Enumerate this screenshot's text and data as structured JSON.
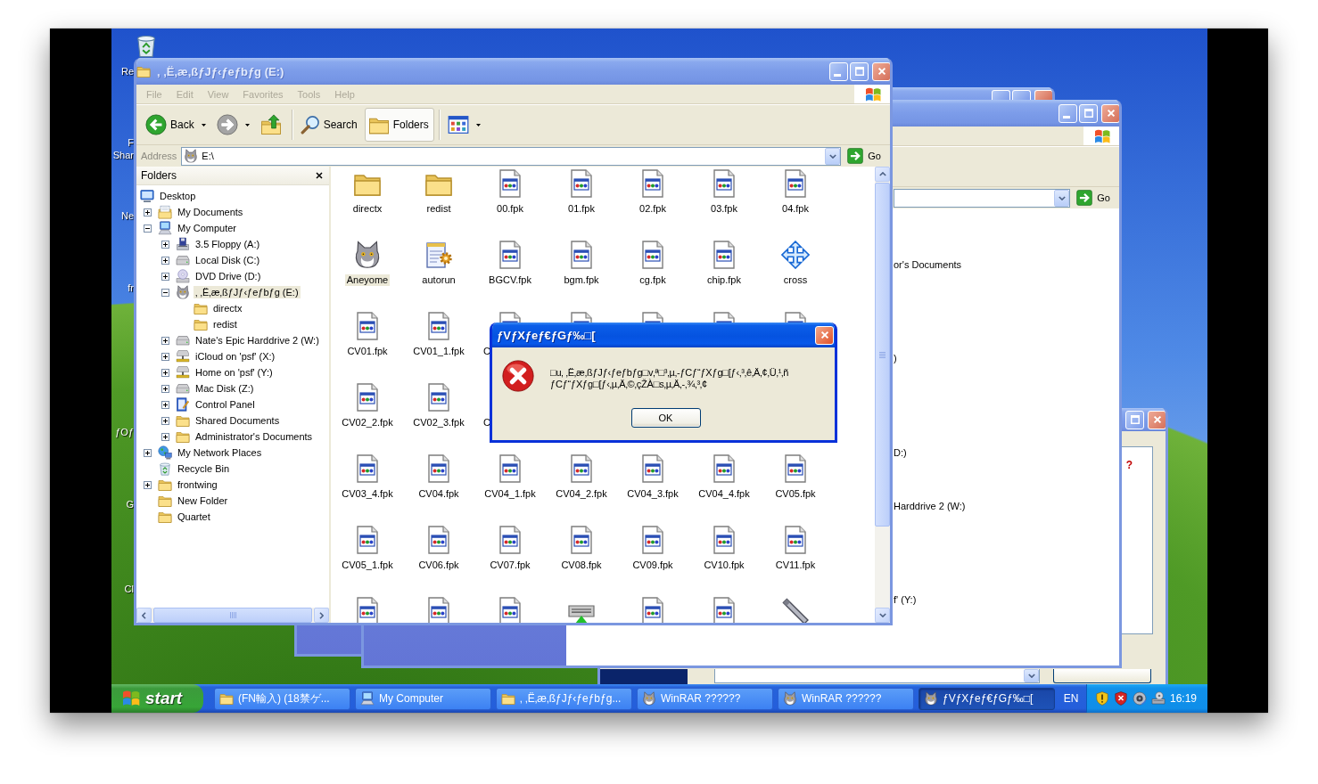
{
  "desktop_icons": [
    {
      "kind": "recycle-bin",
      "label": "Re"
    },
    {
      "label": "F\nShar"
    },
    {
      "label": "Ne"
    },
    {
      "label": "fr"
    },
    {
      "label": "ƒOƒ"
    },
    {
      "label": "G"
    },
    {
      "label": "Cl"
    }
  ],
  "background_windows": [
    {
      "kind": "dialog-window",
      "texts": [
        "?"
      ]
    },
    {
      "kind": "window-frame"
    },
    {
      "kind": "explorer-window",
      "go": "Go",
      "texts": [
        "or's Documents",
        ")",
        "D:)",
        "Harddrive 2 (W:)",
        "f' (Y:)"
      ]
    }
  ],
  "explorer": {
    "title": "‚ ‚Ë‚æ‚ßƒJƒ‹ƒeƒbƒg (E:)",
    "menu": [
      "File",
      "Edit",
      "View",
      "Favorites",
      "Tools",
      "Help"
    ],
    "toolbar": [
      {
        "kind": "back",
        "label": "Back",
        "disabled": false,
        "dropdown": true
      },
      {
        "kind": "forward",
        "disabled": true,
        "dropdown": true
      },
      {
        "kind": "up",
        "disabled": false
      },
      {
        "kind": "separator"
      },
      {
        "kind": "search",
        "label": "Search",
        "pressed": false
      },
      {
        "kind": "folders",
        "label": "Folders",
        "pressed": true
      },
      {
        "kind": "separator"
      },
      {
        "kind": "views",
        "dropdown": true
      }
    ],
    "address": {
      "label": "Address",
      "value": "E:\\",
      "go": "Go"
    },
    "folders_pane": {
      "title": "Folders",
      "tree": [
        {
          "label": "Desktop",
          "kind": "desktop",
          "selected": false,
          "children": [
            {
              "label": "My Documents",
              "kind": "documents",
              "expanded": false,
              "selected": false
            },
            {
              "label": "My Computer",
              "kind": "computer",
              "expanded": true,
              "selected": false,
              "children": [
                {
                  "label": "3.5 Floppy (A:)",
                  "kind": "floppy",
                  "expanded": false,
                  "selected": false
                },
                {
                  "label": "Local Disk (C:)",
                  "kind": "disk",
                  "expanded": false,
                  "selected": false
                },
                {
                  "label": "DVD Drive (D:)",
                  "kind": "dvd",
                  "expanded": false,
                  "selected": false
                },
                {
                  "label": "‚ ‚Ë‚æ‚ßƒJƒ‹ƒeƒbƒg (E:)",
                  "kind": "cat",
                  "expanded": true,
                  "selected": true,
                  "children": [
                    {
                      "label": "directx",
                      "kind": "folder",
                      "selected": false
                    },
                    {
                      "label": "redist",
                      "kind": "folder",
                      "selected": false
                    }
                  ]
                },
                {
                  "label": "Nate's Epic Harddrive 2 (W:)",
                  "kind": "disk",
                  "expanded": false,
                  "selected": false
                },
                {
                  "label": "iCloud on 'psf' (X:)",
                  "kind": "network-drive",
                  "expanded": false,
                  "selected": false
                },
                {
                  "label": "Home on 'psf' (Y:)",
                  "kind": "network-drive",
                  "expanded": false,
                  "selected": false
                },
                {
                  "label": "Mac Disk (Z:)",
                  "kind": "disk",
                  "expanded": false,
                  "selected": false
                },
                {
                  "label": "Control Panel",
                  "kind": "control-panel",
                  "expanded": false,
                  "selected": false
                },
                {
                  "label": "Shared Documents",
                  "kind": "folder",
                  "expanded": false,
                  "selected": false
                },
                {
                  "label": "Administrator's Documents",
                  "kind": "folder",
                  "expanded": false,
                  "selected": false
                }
              ]
            },
            {
              "label": "My Network Places",
              "kind": "network",
              "expanded": false,
              "selected": false
            },
            {
              "label": "Recycle Bin",
              "kind": "recycle-bin",
              "selected": false
            },
            {
              "label": "frontwing",
              "kind": "folder",
              "expanded": false,
              "selected": false
            },
            {
              "label": "New Folder",
              "kind": "folder",
              "selected": false
            },
            {
              "label": "Quartet",
              "kind": "folder",
              "selected": false
            }
          ]
        }
      ]
    },
    "files": {
      "rows": [
        [
          {
            "label": "directx",
            "kind": "folder",
            "selected": false
          },
          {
            "label": "redist",
            "kind": "folder",
            "selected": false
          },
          {
            "label": "00.fpk",
            "kind": "fpk",
            "selected": false
          },
          {
            "label": "01.fpk",
            "kind": "fpk",
            "selected": false
          },
          {
            "label": "02.fpk",
            "kind": "fpk",
            "selected": false
          },
          {
            "label": "03.fpk",
            "kind": "fpk",
            "selected": false
          },
          {
            "label": "04.fpk",
            "kind": "fpk",
            "selected": false
          }
        ],
        [
          {
            "label": "Aneyome",
            "kind": "cat",
            "selected": true
          },
          {
            "label": "autorun",
            "kind": "setup",
            "selected": false
          },
          {
            "label": "BGCV.fpk",
            "kind": "fpk",
            "selected": false
          },
          {
            "label": "bgm.fpk",
            "kind": "fpk",
            "selected": false
          },
          {
            "label": "cg.fpk",
            "kind": "fpk",
            "selected": false
          },
          {
            "label": "chip.fpk",
            "kind": "fpk",
            "selected": false
          },
          {
            "label": "cross",
            "kind": "arrows",
            "selected": false
          }
        ],
        [
          {
            "label": "CV01.fpk",
            "kind": "fpk",
            "selected": false
          },
          {
            "label": "CV01_1.fpk",
            "kind": "fpk",
            "selected": false
          },
          {
            "label": "C",
            "kind": "fpk",
            "covered": true,
            "selected": false
          },
          {
            "kind": "fpk",
            "selected": false
          },
          {
            "kind": "fpk",
            "selected": false
          },
          {
            "kind": "fpk",
            "selected": false
          },
          {
            "kind": "fpk",
            "selected": false
          }
        ],
        [
          {
            "label": "CV02_2.fpk",
            "kind": "fpk",
            "selected": false
          },
          {
            "label": "CV02_3.fpk",
            "kind": "fpk",
            "selected": false
          },
          {
            "label": "C",
            "covered": true,
            "selected": false
          }
        ],
        [
          {
            "label": "CV03_4.fpk",
            "kind": "fpk",
            "selected": false
          },
          {
            "label": "CV04.fpk",
            "kind": "fpk",
            "selected": false
          },
          {
            "label": "CV04_1.fpk",
            "kind": "fpk",
            "selected": false
          },
          {
            "label": "CV04_2.fpk",
            "kind": "fpk",
            "selected": false
          },
          {
            "label": "CV04_3.fpk",
            "kind": "fpk",
            "selected": false
          },
          {
            "label": "CV04_4.fpk",
            "kind": "fpk",
            "selected": false
          },
          {
            "label": "CV05.fpk",
            "kind": "fpk",
            "selected": false
          }
        ],
        [
          {
            "label": "CV05_1.fpk",
            "kind": "fpk",
            "selected": false
          },
          {
            "label": "CV06.fpk",
            "kind": "fpk",
            "selected": false
          },
          {
            "label": "CV07.fpk",
            "kind": "fpk",
            "selected": false
          },
          {
            "label": "CV08.fpk",
            "kind": "fpk",
            "selected": false
          },
          {
            "label": "CV09.fpk",
            "kind": "fpk",
            "selected": false
          },
          {
            "label": "CV10.fpk",
            "kind": "fpk",
            "selected": false
          },
          {
            "label": "CV11.fpk",
            "kind": "fpk",
            "selected": false
          }
        ],
        [
          {
            "kind": "fpk",
            "selected": false
          },
          {
            "kind": "fpk",
            "selected": false
          },
          {
            "kind": "fpk",
            "selected": false
          },
          {
            "kind": "drive",
            "selected": false
          },
          {
            "kind": "fpk",
            "selected": false
          },
          {
            "kind": "fpk",
            "selected": false
          },
          {
            "kind": "pen",
            "selected": false
          }
        ]
      ]
    }
  },
  "dialog": {
    "title": "ƒVƒXƒeƒ€ƒGƒ‰□[",
    "message": "□u‚ ‚Ë‚æ‚ßƒJƒ‹ƒeƒbƒg□v‚ª□³‚µ‚-ƒCƒ“ƒXƒg□[ƒ‹‚³‚ê‚Ä‚¢‚Ü‚¹‚ñ\nƒCƒ“ƒXƒg□[ƒ‹‚µ‚Ä‚©‚çŽÀ□s‚µ‚Ä‚-‚¾‚³‚¢",
    "button": "OK"
  },
  "taskbar": {
    "start": "start",
    "items": [
      {
        "label": "(FN輸入) (18禁ゲ...",
        "kind": "folder",
        "selected": false
      },
      {
        "label": "My Computer",
        "kind": "computer",
        "selected": false
      },
      {
        "label": "‚ ‚Ë‚æ‚ßƒJƒ‹ƒeƒbƒg...",
        "kind": "folder",
        "selected": false
      },
      {
        "label": "WinRAR ??????",
        "kind": "cat",
        "selected": false
      },
      {
        "label": "WinRAR ??????",
        "kind": "cat",
        "selected": false
      },
      {
        "label": "ƒVƒXƒeƒ€ƒGƒ‰□[",
        "kind": "cat",
        "selected": true
      }
    ],
    "language": "EN",
    "clock": "16:19"
  }
}
